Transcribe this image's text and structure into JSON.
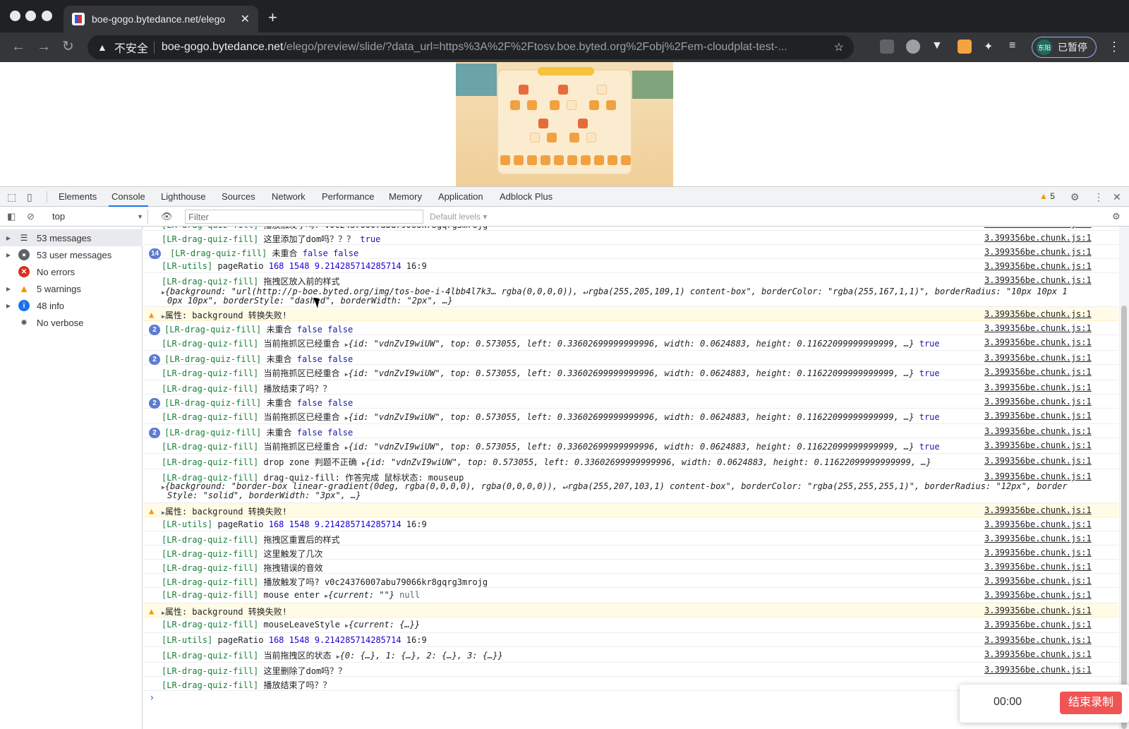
{
  "browser": {
    "tab_title": "boe-gogo.bytedance.net/elego",
    "tab_close": "✕",
    "newtab": "+",
    "insecure_label": "不安全",
    "url_host": "boe-gogo.bytedance.net",
    "url_path": "/elego/preview/slide/?data_url=https%3A%2F%2Ftosv.boe.byted.org%2Fobj%2Fem-cloudplat-test-...",
    "profile_initials": "东阳",
    "profile_status": "已暂停"
  },
  "devtools": {
    "tabs": [
      "Elements",
      "Console",
      "Lighthouse",
      "Sources",
      "Network",
      "Performance",
      "Memory",
      "Application",
      "Adblock Plus"
    ],
    "warning_count": "5",
    "context": "top",
    "filter_placeholder": "Filter",
    "levels": "Default levels ▾",
    "sidebar": [
      {
        "label": "53 messages",
        "icon": "list-icon"
      },
      {
        "label": "53 user messages",
        "icon": "user-icon"
      },
      {
        "label": "No errors",
        "icon": "error-icon"
      },
      {
        "label": "5 warnings",
        "icon": "warning-icon"
      },
      {
        "label": "48 info",
        "icon": "info-icon"
      },
      {
        "label": "No verbose",
        "icon": "bug-icon"
      }
    ],
    "source": "3.399356be.chunk.js:1",
    "messages": {
      "m0_tag": "[LR-drag-quiz-fill]",
      "m0_txt": "  播放触发了吗?   v0c24376007abu79066kr8gqrg3mrojg",
      "m1_txt": "  这里添加了dom吗？？？  ",
      "m1_val": "true",
      "m2_badge": "14",
      "m2_txt": "  未重合    ",
      "m2_val": "false false",
      "m3_tag": "[LR-utils]",
      "m3_txt": "  pageRatio ",
      "m3_num": "168 1548 9.214285714285714",
      "m3_ratio": " 16:9",
      "m4_txt": "  拖拽区放入前的样式",
      "m4_sub1": "{background: \"url(http://p-boe.byted.org/img/tos-boe-i-4lbb4l7k3… rgba(0,0,0,0)), ↵rgba(255,205,109,1) content-box\", borderColor: \"rgba(255,167,1,1)\", borderRadius: \"10px 10px 1",
      "m4_sub2": "0px 10px\", borderStyle: \"dashed\", borderWidth: \"2px\", …}",
      "w_attr": "属性:  background 转换失败!",
      "m6_badge": "2",
      "m7_txt": "  当前拖抓区已经重合  ",
      "m7_obj": "{id: \"vdnZvI9wiUW\", top: 0.573055, left: 0.33602699999999996, width: 0.0624883, height: 0.11622099999999999, …}",
      "m10_txt": "  播放结束了吗？？",
      "m15_txt": "    drop zone 判题不正确  ",
      "m16_txt": "  drag-quiz-fill: 作答完成 鼠标状态: mouseup",
      "m16_sub1": "{background: \"border-box linear-gradient(0deg, rgba(0,0,0,0), rgba(0,0,0,0)), ↵rgba(255,207,103,1) content-box\", borderColor: \"rgba(255,255,255,1)\", borderRadius: \"12px\", border",
      "m16_sub2": "Style: \"solid\", borderWidth: \"3px\", …}",
      "m19_txt": "  拖拽区重置后的样式",
      "m20_txt": "  这里触发了几次",
      "m21_txt": "  拖拽错误的音效",
      "m23_txt": "  mouse enter ",
      "m23_obj": "{current: \"\"}",
      "m23_null": " null",
      "m25_txt": "  mouseLeaveStyle  ",
      "m25_obj": "{current: {…}}",
      "m27_txt": "  当前拖拽区的状态   ",
      "m27_obj": "{0: {…}, 1: {…}, 2: {…}, 3: {…}}",
      "m28_txt": "  这里删除了dom吗？？"
    }
  },
  "recorder": {
    "timer": "00:00",
    "stop_label": "结束录制"
  }
}
